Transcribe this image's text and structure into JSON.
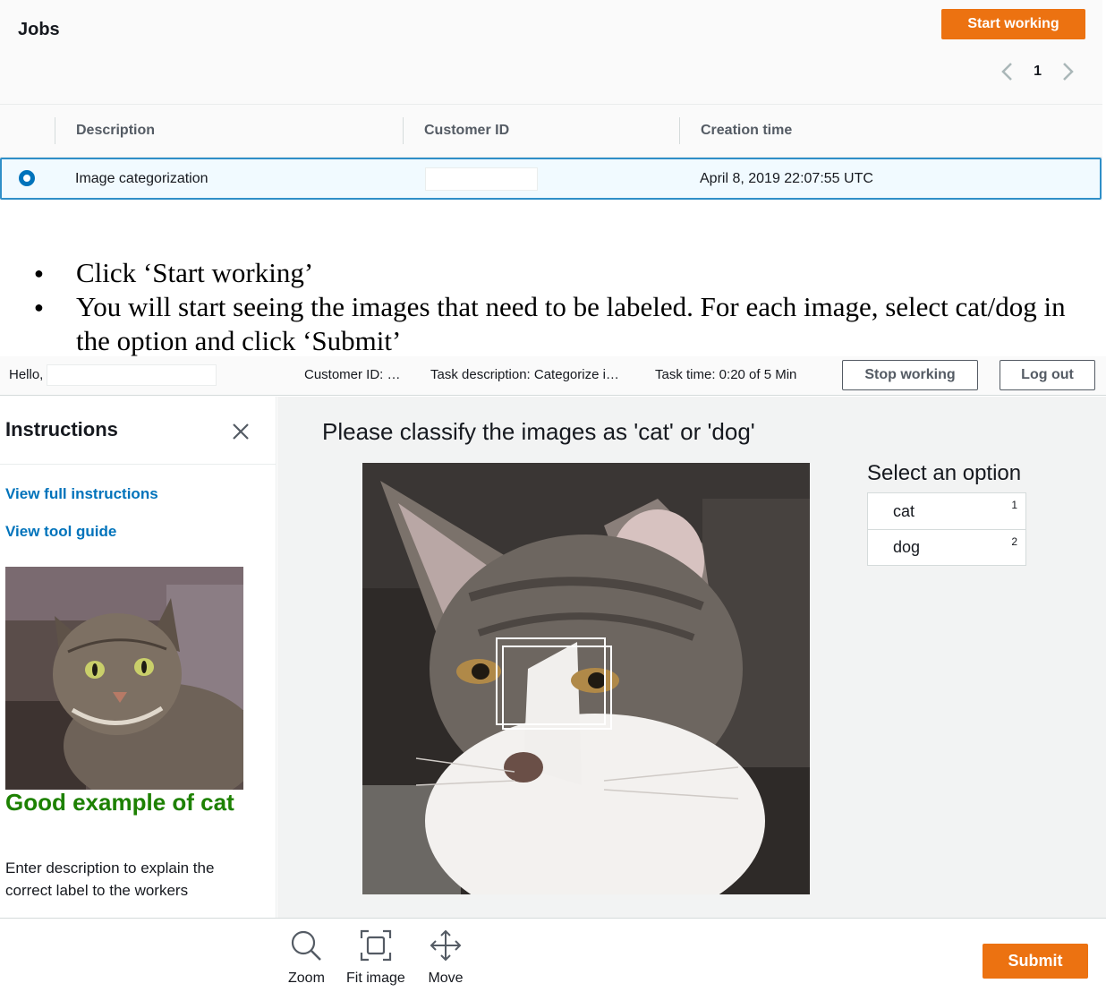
{
  "jobs": {
    "title": "Jobs",
    "start_button": "Start working",
    "page": "1",
    "columns": [
      "Description",
      "Customer ID",
      "Creation time"
    ],
    "row": {
      "description": "Image categorization",
      "customer_id": "",
      "creation_time": "April 8, 2019 22:07:55 UTC"
    }
  },
  "instructions_text": {
    "bullet1": "Click ‘Start working’",
    "bullet2": "You will start seeing the images that need to be labeled.  For each image, select cat/dog in the option and click ‘Submit’"
  },
  "worker_bar": {
    "hello": "Hello,",
    "customer_id": "Customer ID: …",
    "task_description": "Task description: Categorize i…",
    "task_time": "Task time: 0:20 of 5 Min",
    "stop_button": "Stop working",
    "logout_button": "Log out"
  },
  "sidebar": {
    "title": "Instructions",
    "link_full": "View full instructions",
    "link_tool": "View tool guide",
    "example_caption": "Good example of cat",
    "description": "Enter description to explain the correct label to the workers"
  },
  "task": {
    "question": "Please classify the images as 'cat' or 'dog'",
    "select_title": "Select an option",
    "options": [
      {
        "label": "cat",
        "key": "1"
      },
      {
        "label": "dog",
        "key": "2"
      }
    ]
  },
  "toolbar": {
    "zoom": "Zoom",
    "fit": "Fit image",
    "move": "Move",
    "submit": "Submit"
  },
  "colors": {
    "accent_orange": "#ec7211",
    "link_blue": "#0073bb",
    "good_green": "#1d8102"
  }
}
